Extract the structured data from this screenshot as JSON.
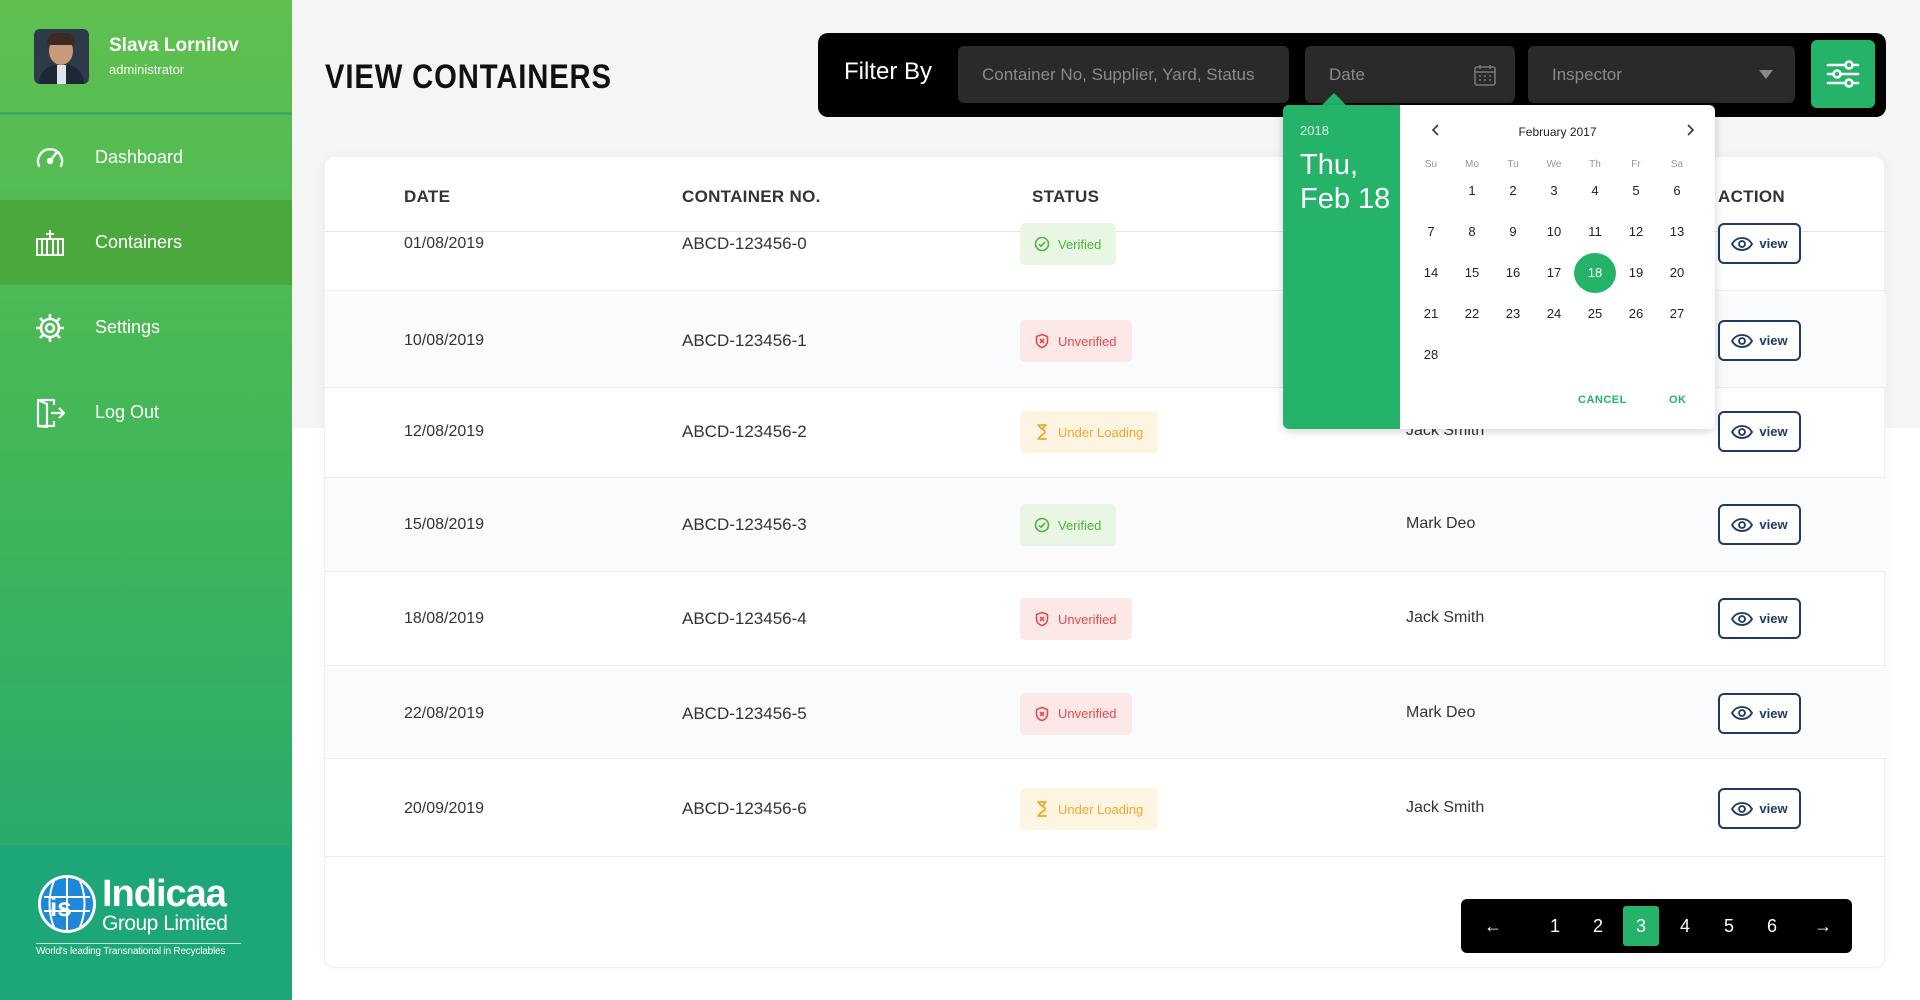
{
  "user": {
    "name": "Slava Lornilov",
    "role": "administrator"
  },
  "nav": [
    {
      "label": "Dashboard",
      "icon": "speedometer-icon"
    },
    {
      "label": "Containers",
      "icon": "container-icon"
    },
    {
      "label": "Settings",
      "icon": "gear-icon"
    },
    {
      "label": "Log Out",
      "icon": "logout-icon"
    }
  ],
  "logo": {
    "title": "Indicaa",
    "subtitle": "Group Limited",
    "tagline": "World's leading Transnational in Recyclables"
  },
  "page_title": "VIEW CONTAINERS",
  "filter": {
    "label": "Filter By",
    "search_placeholder": "Container No, Supplier, Yard, Status",
    "date_placeholder": "Date",
    "inspector_placeholder": "Inspector"
  },
  "table": {
    "headers": {
      "date": "DATE",
      "container": "CONTAINER NO.",
      "status": "STATUS",
      "action": "ACTION"
    },
    "view_label": "view",
    "rows": [
      {
        "date": "01/08/2019",
        "container": "ABCD-123456-0",
        "status": "Verified",
        "inspector": ""
      },
      {
        "date": "10/08/2019",
        "container": "ABCD-123456-1",
        "status": "Unverified",
        "inspector": ""
      },
      {
        "date": "12/08/2019",
        "container": "ABCD-123456-2",
        "status": "Under Loading",
        "inspector": "Jack Smith"
      },
      {
        "date": "15/08/2019",
        "container": "ABCD-123456-3",
        "status": "Verified",
        "inspector": "Mark Deo"
      },
      {
        "date": "18/08/2019",
        "container": "ABCD-123456-4",
        "status": "Unverified",
        "inspector": "Jack Smith"
      },
      {
        "date": "22/08/2019",
        "container": "ABCD-123456-5",
        "status": "Unverified",
        "inspector": "Mark Deo"
      },
      {
        "date": "20/09/2019",
        "container": "ABCD-123456-6",
        "status": "Under Loading",
        "inspector": "Jack Smith"
      }
    ]
  },
  "pagination": {
    "pages": [
      "1",
      "2",
      "3",
      "4",
      "5",
      "6"
    ],
    "current": "3",
    "prev": "←",
    "next": "→"
  },
  "calendar": {
    "year": "2018",
    "selected_label": "Thu,\nFeb 18",
    "month_label": "February 2017",
    "weekdays": [
      "Su",
      "Mo",
      "Tu",
      "We",
      "Th",
      "Fr",
      "Sa"
    ],
    "first_weekday_offset": 1,
    "days_in_month": 28,
    "selected_day": 18,
    "cancel": "CANCEL",
    "ok": "OK"
  },
  "colors": {
    "accent": "#25b36a",
    "sidebar_top": "#5fc04f",
    "sidebar_bottom": "#1ea677",
    "navy": "#1f3a63"
  }
}
